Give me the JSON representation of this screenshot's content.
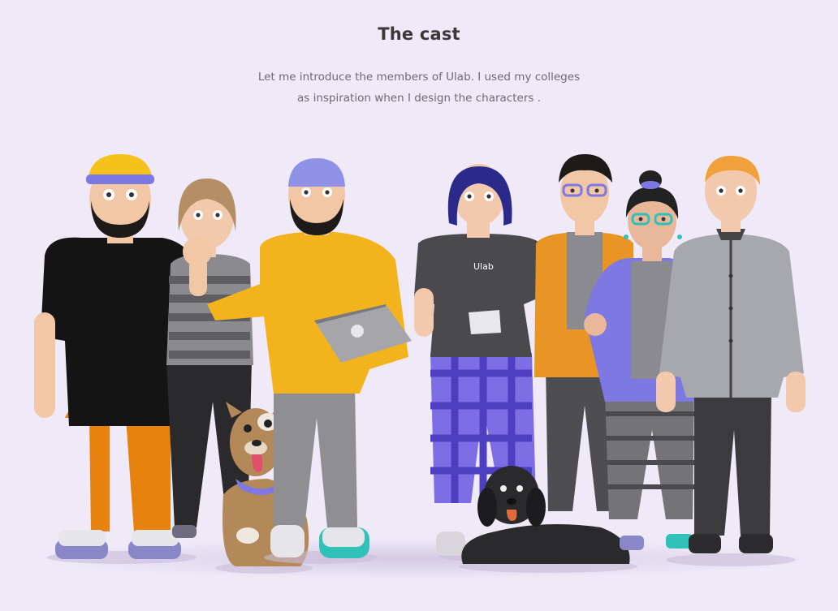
{
  "section": {
    "title": "The cast",
    "intro_line1": "Let me introduce the members of Ulab. I used my colleges",
    "intro_line2": "as inspiration when I design the characters ."
  },
  "characters": [
    {
      "id": "bearded-man-yellow-cap",
      "shirt": "#141414",
      "pants": "#e8820f",
      "skin": "#f1c7a6",
      "hair": "#1d1a18",
      "hat": "#f4c21a"
    },
    {
      "id": "woman-striped-shirt",
      "shirt": "#8a8a8f",
      "pants": "#2a2a2c",
      "skin": "#f2c9ad",
      "hair": "#b48e64"
    },
    {
      "id": "man-yellow-hoodie-laptop",
      "shirt": "#f2b31c",
      "pants": "#8e8e93",
      "skin": "#f1c7a6",
      "hair": "#1d1a18",
      "hat": "#8f92e6"
    },
    {
      "id": "woman-ulab-tee-mug",
      "shirt": "#4a4a4e",
      "pants": "#7d6ee6",
      "skin": "#f2c9ad",
      "hair": "#2a2a8a",
      "shirt_print": "Ulab"
    },
    {
      "id": "man-orange-cardigan-glasses",
      "shirt": "#e89526",
      "pants": "#4e4e52",
      "skin": "#f1c7a6",
      "hair": "#1d1a18"
    },
    {
      "id": "woman-purple-jacket-glasses",
      "shirt": "#7e78e3",
      "pants": "#737378",
      "skin": "#e9b79a",
      "hair": "#222"
    },
    {
      "id": "man-gray-shirt-redhead",
      "shirt": "#a7a8ad",
      "pants": "#3b3b3e",
      "skin": "#f2c9ad",
      "hair": "#f0a13b"
    }
  ],
  "pets": [
    {
      "id": "brown-dog",
      "fur": "#b4895a",
      "scarf": "#7e78e3"
    },
    {
      "id": "black-fluffy-dog",
      "fur": "#2a2a2c"
    }
  ]
}
